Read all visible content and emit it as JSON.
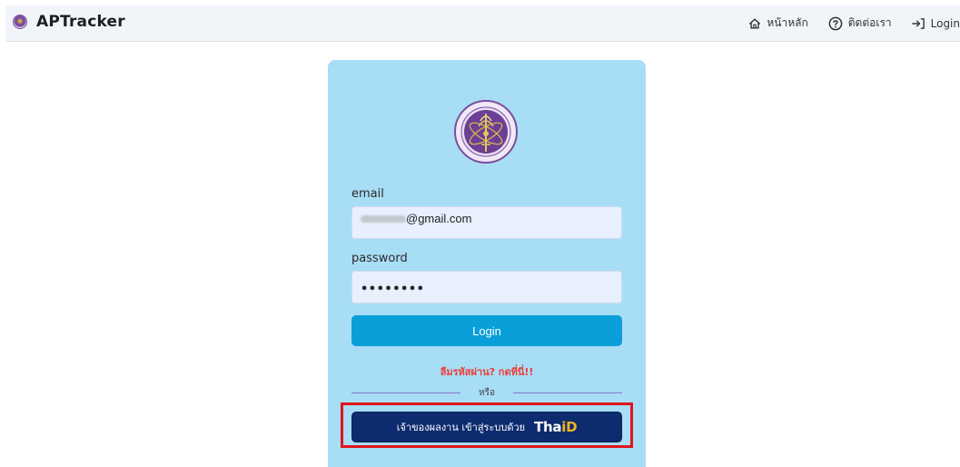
{
  "brand": {
    "name": "APTracker"
  },
  "nav": {
    "home": "หน้าหลัก",
    "contact": "ติดต่อเรา",
    "login": "Login"
  },
  "form": {
    "email_label": "email",
    "email_value": "@gmail.com",
    "password_label": "password",
    "password_value": "••••••••",
    "login_button": "Login",
    "forgot": "ลืมรหัสผ่าน? กดที่นี่!!",
    "divider": "หรือ",
    "thaid_button": "เจ้าของผลงาน เข้าสู่ระบบด้วย",
    "thaid_logo_main": "Tha",
    "thaid_logo_accent": "iD"
  },
  "colors": {
    "card_background": "#a8ddf6",
    "login_button": "#0a9fd8",
    "thaid_button": "#0d2b6f",
    "forgot_text": "#ef3e36",
    "highlight": "#e0151c"
  },
  "icons": {
    "brand": "organization-emblem-icon",
    "home": "home-icon",
    "contact": "question-circle-icon",
    "login": "login-arrow-icon",
    "emblem": "ministry-emblem-icon"
  }
}
